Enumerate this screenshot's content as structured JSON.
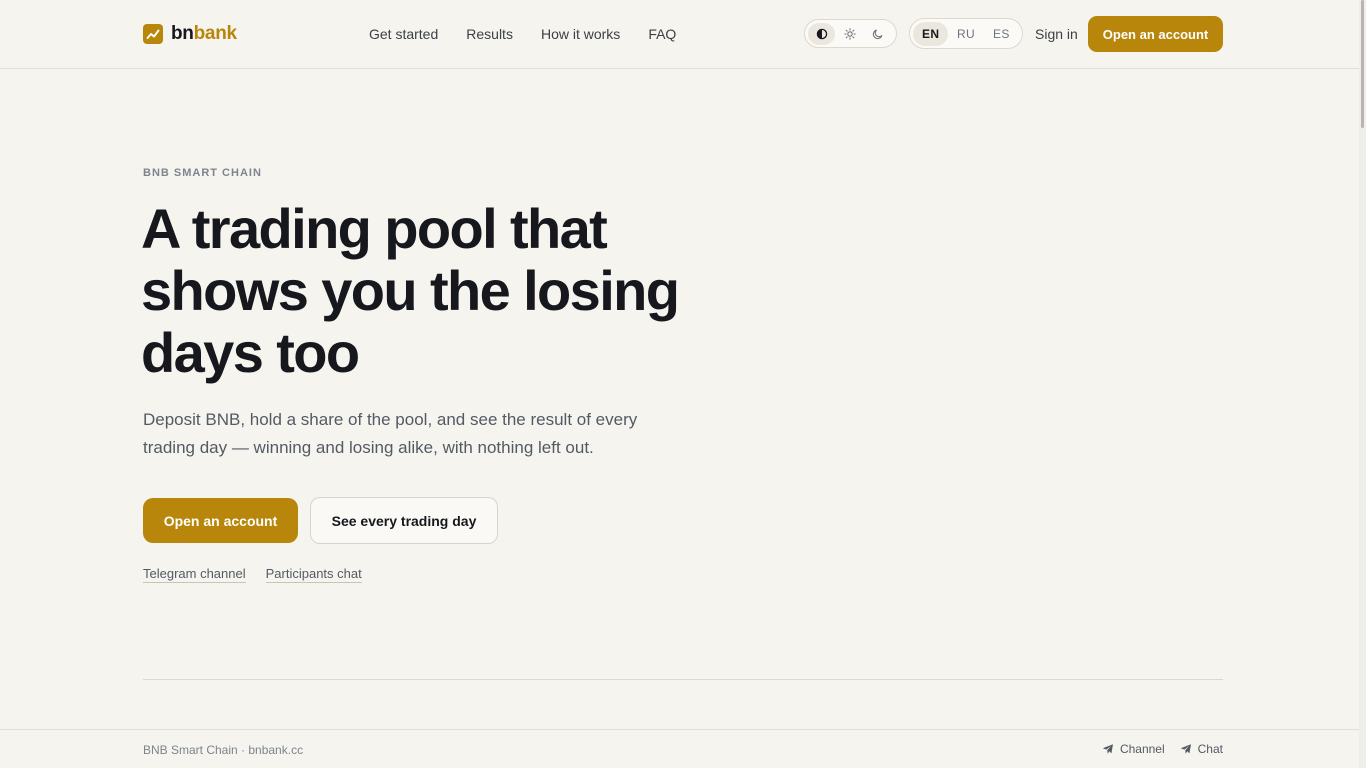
{
  "colors": {
    "accent": "#b8860b",
    "background": "#f6f4ef",
    "text": "#16181d",
    "muted": "#545a64"
  },
  "header": {
    "logo": {
      "part1": "bn",
      "part2": "bank",
      "icon": "trend-up-icon"
    },
    "nav": [
      "Get started",
      "Results",
      "How it works",
      "FAQ"
    ],
    "theme_toggle": {
      "options": [
        "contrast-icon",
        "sun-icon",
        "moon-icon"
      ],
      "active": 0
    },
    "languages": {
      "options": [
        "EN",
        "RU",
        "ES"
      ],
      "active": "EN"
    },
    "sign_in": "Sign in",
    "cta": "Open an account"
  },
  "hero": {
    "eyebrow": "BNB SMART CHAIN",
    "headline": "A trading pool that shows you the losing days too",
    "subtext": "Deposit BNB, hold a share of the pool, and see the result of every trading day — winning and losing alike, with nothing left out.",
    "primary_cta": "Open an account",
    "secondary_cta": "See every trading day",
    "links": [
      "Telegram channel",
      "Participants chat"
    ]
  },
  "footer": {
    "left": "BNB Smart Chain · bnbank.cc",
    "links": [
      {
        "label": "Channel",
        "icon": "telegram-icon"
      },
      {
        "label": "Chat",
        "icon": "telegram-icon"
      }
    ]
  }
}
